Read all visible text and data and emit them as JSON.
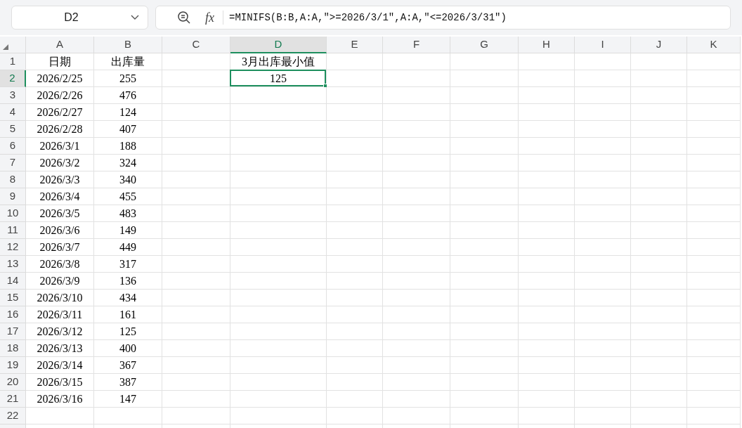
{
  "name_box": "D2",
  "function_button": "fx",
  "formula": "=MINIFS(B:B,A:A,″>=2026/3/1″,A:A,″<=2026/3/31″)",
  "columns": [
    {
      "label": "A",
      "selected": false
    },
    {
      "label": "B",
      "selected": false
    },
    {
      "label": "C",
      "selected": false
    },
    {
      "label": "D",
      "selected": true
    },
    {
      "label": "E",
      "selected": false
    },
    {
      "label": "F",
      "selected": false
    },
    {
      "label": "G",
      "selected": false
    },
    {
      "label": "H",
      "selected": false
    },
    {
      "label": "I",
      "selected": false
    },
    {
      "label": "J",
      "selected": false
    },
    {
      "label": "K",
      "selected": false
    }
  ],
  "rows": [
    {
      "label": "1",
      "selected": false,
      "cells": [
        "日期",
        "出库量",
        null,
        "3月出库最小值"
      ]
    },
    {
      "label": "2",
      "selected": true,
      "cells": [
        "2026/2/25",
        "255",
        null,
        "125"
      ]
    },
    {
      "label": "3",
      "selected": false,
      "cells": [
        "2026/2/26",
        "476"
      ]
    },
    {
      "label": "4",
      "selected": false,
      "cells": [
        "2026/2/27",
        "124"
      ]
    },
    {
      "label": "5",
      "selected": false,
      "cells": [
        "2026/2/28",
        "407"
      ]
    },
    {
      "label": "6",
      "selected": false,
      "cells": [
        "2026/3/1",
        "188"
      ]
    },
    {
      "label": "7",
      "selected": false,
      "cells": [
        "2026/3/2",
        "324"
      ]
    },
    {
      "label": "8",
      "selected": false,
      "cells": [
        "2026/3/3",
        "340"
      ]
    },
    {
      "label": "9",
      "selected": false,
      "cells": [
        "2026/3/4",
        "455"
      ]
    },
    {
      "label": "10",
      "selected": false,
      "cells": [
        "2026/3/5",
        "483"
      ]
    },
    {
      "label": "11",
      "selected": false,
      "cells": [
        "2026/3/6",
        "149"
      ]
    },
    {
      "label": "12",
      "selected": false,
      "cells": [
        "2026/3/7",
        "449"
      ]
    },
    {
      "label": "13",
      "selected": false,
      "cells": [
        "2026/3/8",
        "317"
      ]
    },
    {
      "label": "14",
      "selected": false,
      "cells": [
        "2026/3/9",
        "136"
      ]
    },
    {
      "label": "15",
      "selected": false,
      "cells": [
        "2026/3/10",
        "434"
      ]
    },
    {
      "label": "16",
      "selected": false,
      "cells": [
        "2026/3/11",
        "161"
      ]
    },
    {
      "label": "17",
      "selected": false,
      "cells": [
        "2026/3/12",
        "125"
      ]
    },
    {
      "label": "18",
      "selected": false,
      "cells": [
        "2026/3/13",
        "400"
      ]
    },
    {
      "label": "19",
      "selected": false,
      "cells": [
        "2026/3/14",
        "367"
      ]
    },
    {
      "label": "20",
      "selected": false,
      "cells": [
        "2026/3/15",
        "387"
      ]
    },
    {
      "label": "21",
      "selected": false,
      "cells": [
        "2026/3/16",
        "147"
      ]
    },
    {
      "label": "22",
      "selected": false,
      "cells": []
    }
  ]
}
